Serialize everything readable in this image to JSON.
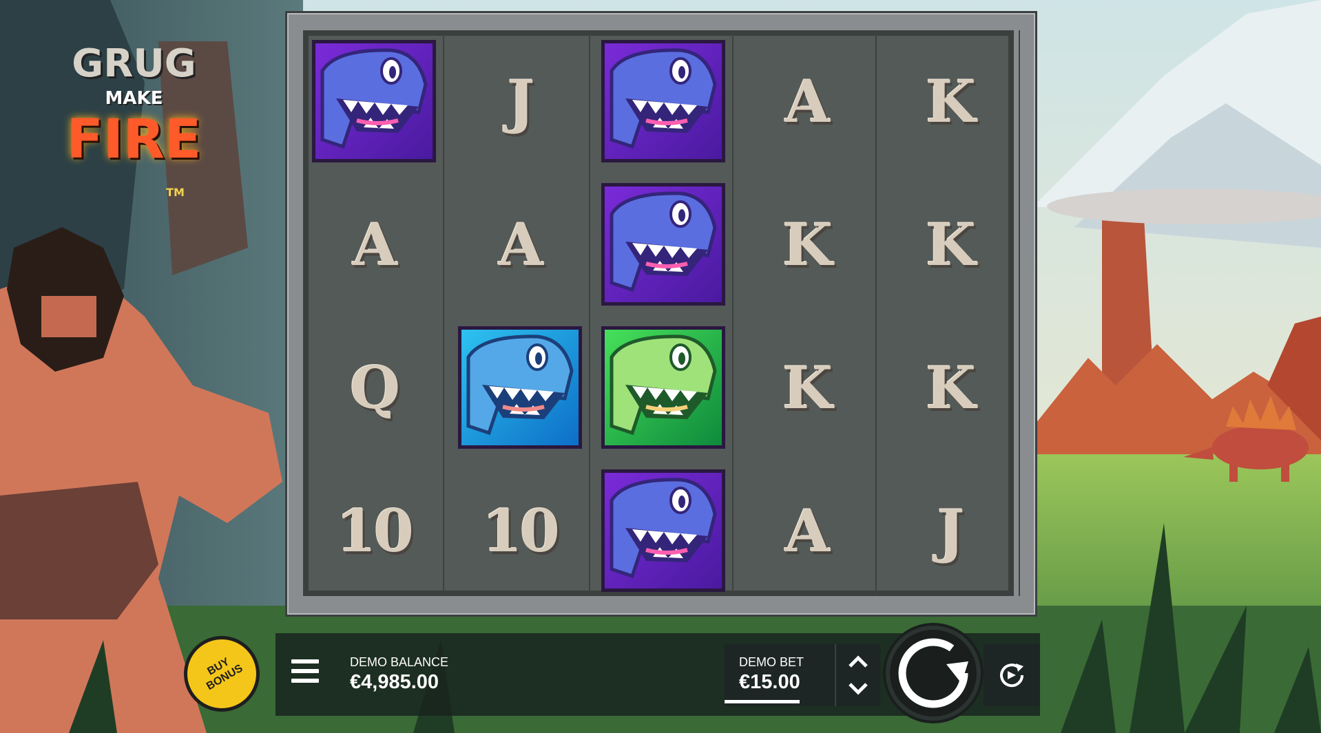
{
  "game": {
    "logo_line1": "GRUG",
    "logo_line2": "MAKE",
    "logo_line3": "FIRE",
    "logo_tm": "TM"
  },
  "reels": [
    [
      {
        "symbol": "purple-dino"
      },
      {
        "symbol": "letter",
        "text": "A"
      },
      {
        "symbol": "letter",
        "text": "Q"
      },
      {
        "symbol": "letter",
        "text": "10"
      }
    ],
    [
      {
        "symbol": "letter",
        "text": "J"
      },
      {
        "symbol": "letter",
        "text": "A"
      },
      {
        "symbol": "blue-dino"
      },
      {
        "symbol": "letter",
        "text": "10"
      }
    ],
    [
      {
        "symbol": "purple-dino"
      },
      {
        "symbol": "purple-dino"
      },
      {
        "symbol": "green-dino"
      },
      {
        "symbol": "purple-dino"
      }
    ],
    [
      {
        "symbol": "letter",
        "text": "A"
      },
      {
        "symbol": "letter",
        "text": "K"
      },
      {
        "symbol": "letter",
        "text": "K"
      },
      {
        "symbol": "letter",
        "text": "A"
      }
    ],
    [
      {
        "symbol": "letter",
        "text": "K"
      },
      {
        "symbol": "letter",
        "text": "K"
      },
      {
        "symbol": "letter",
        "text": "K"
      },
      {
        "symbol": "letter",
        "text": "J"
      }
    ]
  ],
  "controls": {
    "buy_bonus_line1": "BUY",
    "buy_bonus_line2": "BONUS",
    "balance_label": "DEMO BALANCE",
    "balance_value": "€4,985.00",
    "bet_label": "DEMO BET",
    "bet_value": "€15.00",
    "menu_icon": "hamburger-menu-icon",
    "spin_icon": "spin-arrow-icon",
    "autoplay_icon": "autoplay-icon",
    "bet_arrows_icon": "chevron-up-down-icon"
  },
  "colors": {
    "buy_bonus": "#f5c61a",
    "purple_dino": "#7a2bd8",
    "blue_dino": "#2ec2f0",
    "green_dino": "#46e05a"
  }
}
